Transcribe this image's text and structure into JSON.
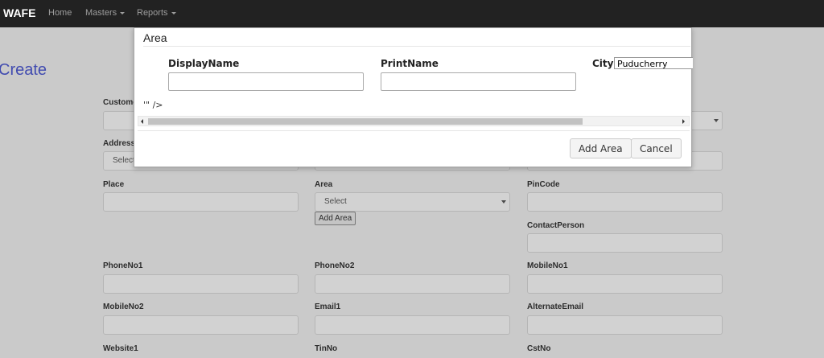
{
  "navbar": {
    "brand": "WAFE",
    "items": [
      {
        "label": "Home"
      },
      {
        "label": "Masters"
      },
      {
        "label": "Reports"
      }
    ]
  },
  "page": {
    "title": "Create",
    "fields": {
      "customer": {
        "label": "Custome"
      },
      "address": {
        "label": "Address",
        "select_value": "Select"
      },
      "place": {
        "label": "Place"
      },
      "area": {
        "label": "Area",
        "select_value": "Select",
        "add_button": "Add Area"
      },
      "pincode": {
        "label": "PinCode"
      },
      "contact_person": {
        "label": "ContactPerson"
      },
      "phone1": {
        "label": "PhoneNo1"
      },
      "phone2": {
        "label": "PhoneNo2"
      },
      "mobile1": {
        "label": "MobileNo1"
      },
      "mobile2": {
        "label": "MobileNo2"
      },
      "email1": {
        "label": "Email1"
      },
      "alt_email": {
        "label": "AlternateEmail"
      },
      "website": {
        "label": "Website1"
      },
      "tin": {
        "label": "TinNo"
      },
      "cst": {
        "label": "CstNo"
      }
    }
  },
  "modal": {
    "title": "Area",
    "display_name_label": "DisplayName",
    "print_name_label": "PrintName",
    "city_label": "City",
    "city_value": "Puducherry",
    "stray_text": "'\" />",
    "add_button": "Add Area",
    "cancel_button": "Cancel"
  }
}
